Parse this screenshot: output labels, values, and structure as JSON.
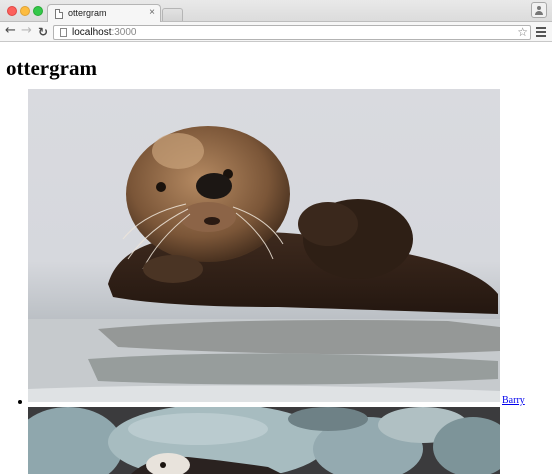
{
  "browser": {
    "tab_title": "ottergram",
    "tab_close": "×",
    "url_host": "localhost",
    "url_port": ":3000"
  },
  "page": {
    "title": "ottergram",
    "thumbnails": [
      {
        "label": "Barry",
        "image": "sea-otter-floating-in-water"
      },
      {
        "label": "",
        "image": "sea-otter-lying-on-rocks"
      }
    ]
  }
}
